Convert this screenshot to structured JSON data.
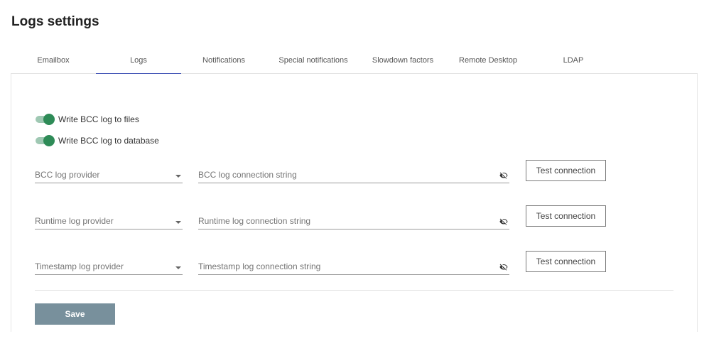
{
  "page": {
    "title": "Logs settings"
  },
  "tabs": [
    {
      "label": "Emailbox"
    },
    {
      "label": "Logs",
      "active": true
    },
    {
      "label": "Notifications"
    },
    {
      "label": "Special notifications"
    },
    {
      "label": "Slowdown factors"
    },
    {
      "label": "Remote Desktop"
    },
    {
      "label": "LDAP"
    }
  ],
  "toggles": {
    "files": {
      "label": "Write BCC log to files",
      "on": true
    },
    "database": {
      "label": "Write BCC log to database",
      "on": true
    }
  },
  "rows": [
    {
      "provider_placeholder": "BCC log provider",
      "connection_placeholder": "BCC log connection string",
      "test_label": "Test connection"
    },
    {
      "provider_placeholder": "Runtime log provider",
      "connection_placeholder": "Runtime log connection string",
      "test_label": "Test connection"
    },
    {
      "provider_placeholder": "Timestamp log provider",
      "connection_placeholder": "Timestamp log connection string",
      "test_label": "Test connection"
    }
  ],
  "actions": {
    "save_label": "Save"
  },
  "colors": {
    "toggle_on": "#2e8b57",
    "toggle_track": "#9fc8b3",
    "active_tab_underline": "#3f51b5",
    "save_button": "#78909c"
  }
}
